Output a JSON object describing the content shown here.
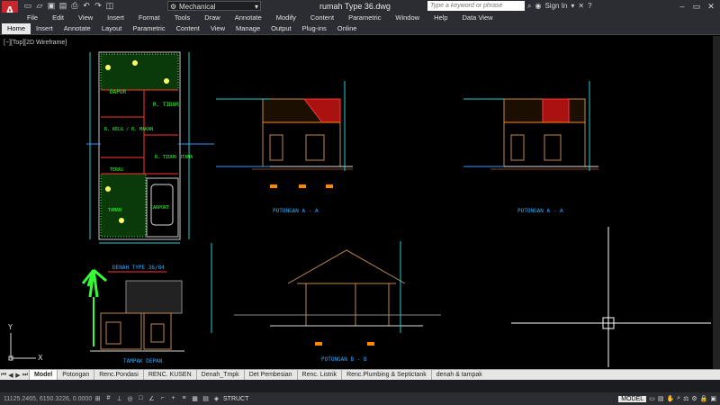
{
  "app": {
    "logo": "A",
    "document_title": "rumah Type 36.dwg"
  },
  "workspace": {
    "label": "Mechanical"
  },
  "search": {
    "placeholder": "Type a keyword or phrase"
  },
  "account": {
    "sign_in": "Sign In"
  },
  "menu": [
    "File",
    "Edit",
    "View",
    "Insert",
    "Format",
    "Tools",
    "Draw",
    "Annotate",
    "Modify",
    "Content",
    "Parametric",
    "Window",
    "Help",
    "Data View"
  ],
  "ribbon_tabs": [
    "Home",
    "Insert",
    "Annotate",
    "Layout",
    "Parametric",
    "Content",
    "View",
    "Manage",
    "Output",
    "Plug-ins",
    "Online"
  ],
  "viewport_label": "[−][Top][2D Wireframe]",
  "drawing": {
    "plan_title": "DENAH TYPE 36/84",
    "front_title": "TAMPAK DEPAN",
    "section_aa_1": "POTONGAN  A - A",
    "section_aa_2": "POTONGAN  A - A",
    "section_bb": "POTONGAN  B - B",
    "rooms": [
      "DAPUR",
      "R. TIDUR",
      "R. KELG / R. MAKAN",
      "R. TIDUR UTAMA",
      "TERAS",
      "CARPORT",
      "TAMAN"
    ]
  },
  "layout_tabs": [
    "Model",
    "Potongan",
    "Renc.Pondasi",
    "RENC. KUSEN",
    "Denah_Tmpk",
    "Det Pembesian",
    "Renc. Listrik",
    "Renc.Plumbing & Septictank",
    "denah & tampak"
  ],
  "status": {
    "coords": "11125.2465, 6150.3226, 0.0000",
    "struct": "STRUCT",
    "model": "MODEL"
  },
  "colors": {
    "ui_dark": "#2b2d33",
    "canvas": "#000000",
    "cad_green": "#33ff33",
    "cad_red": "#ff3333",
    "cad_cyan": "#22cccc",
    "cad_orange": "#ff8800",
    "cad_brown": "#c08850"
  }
}
